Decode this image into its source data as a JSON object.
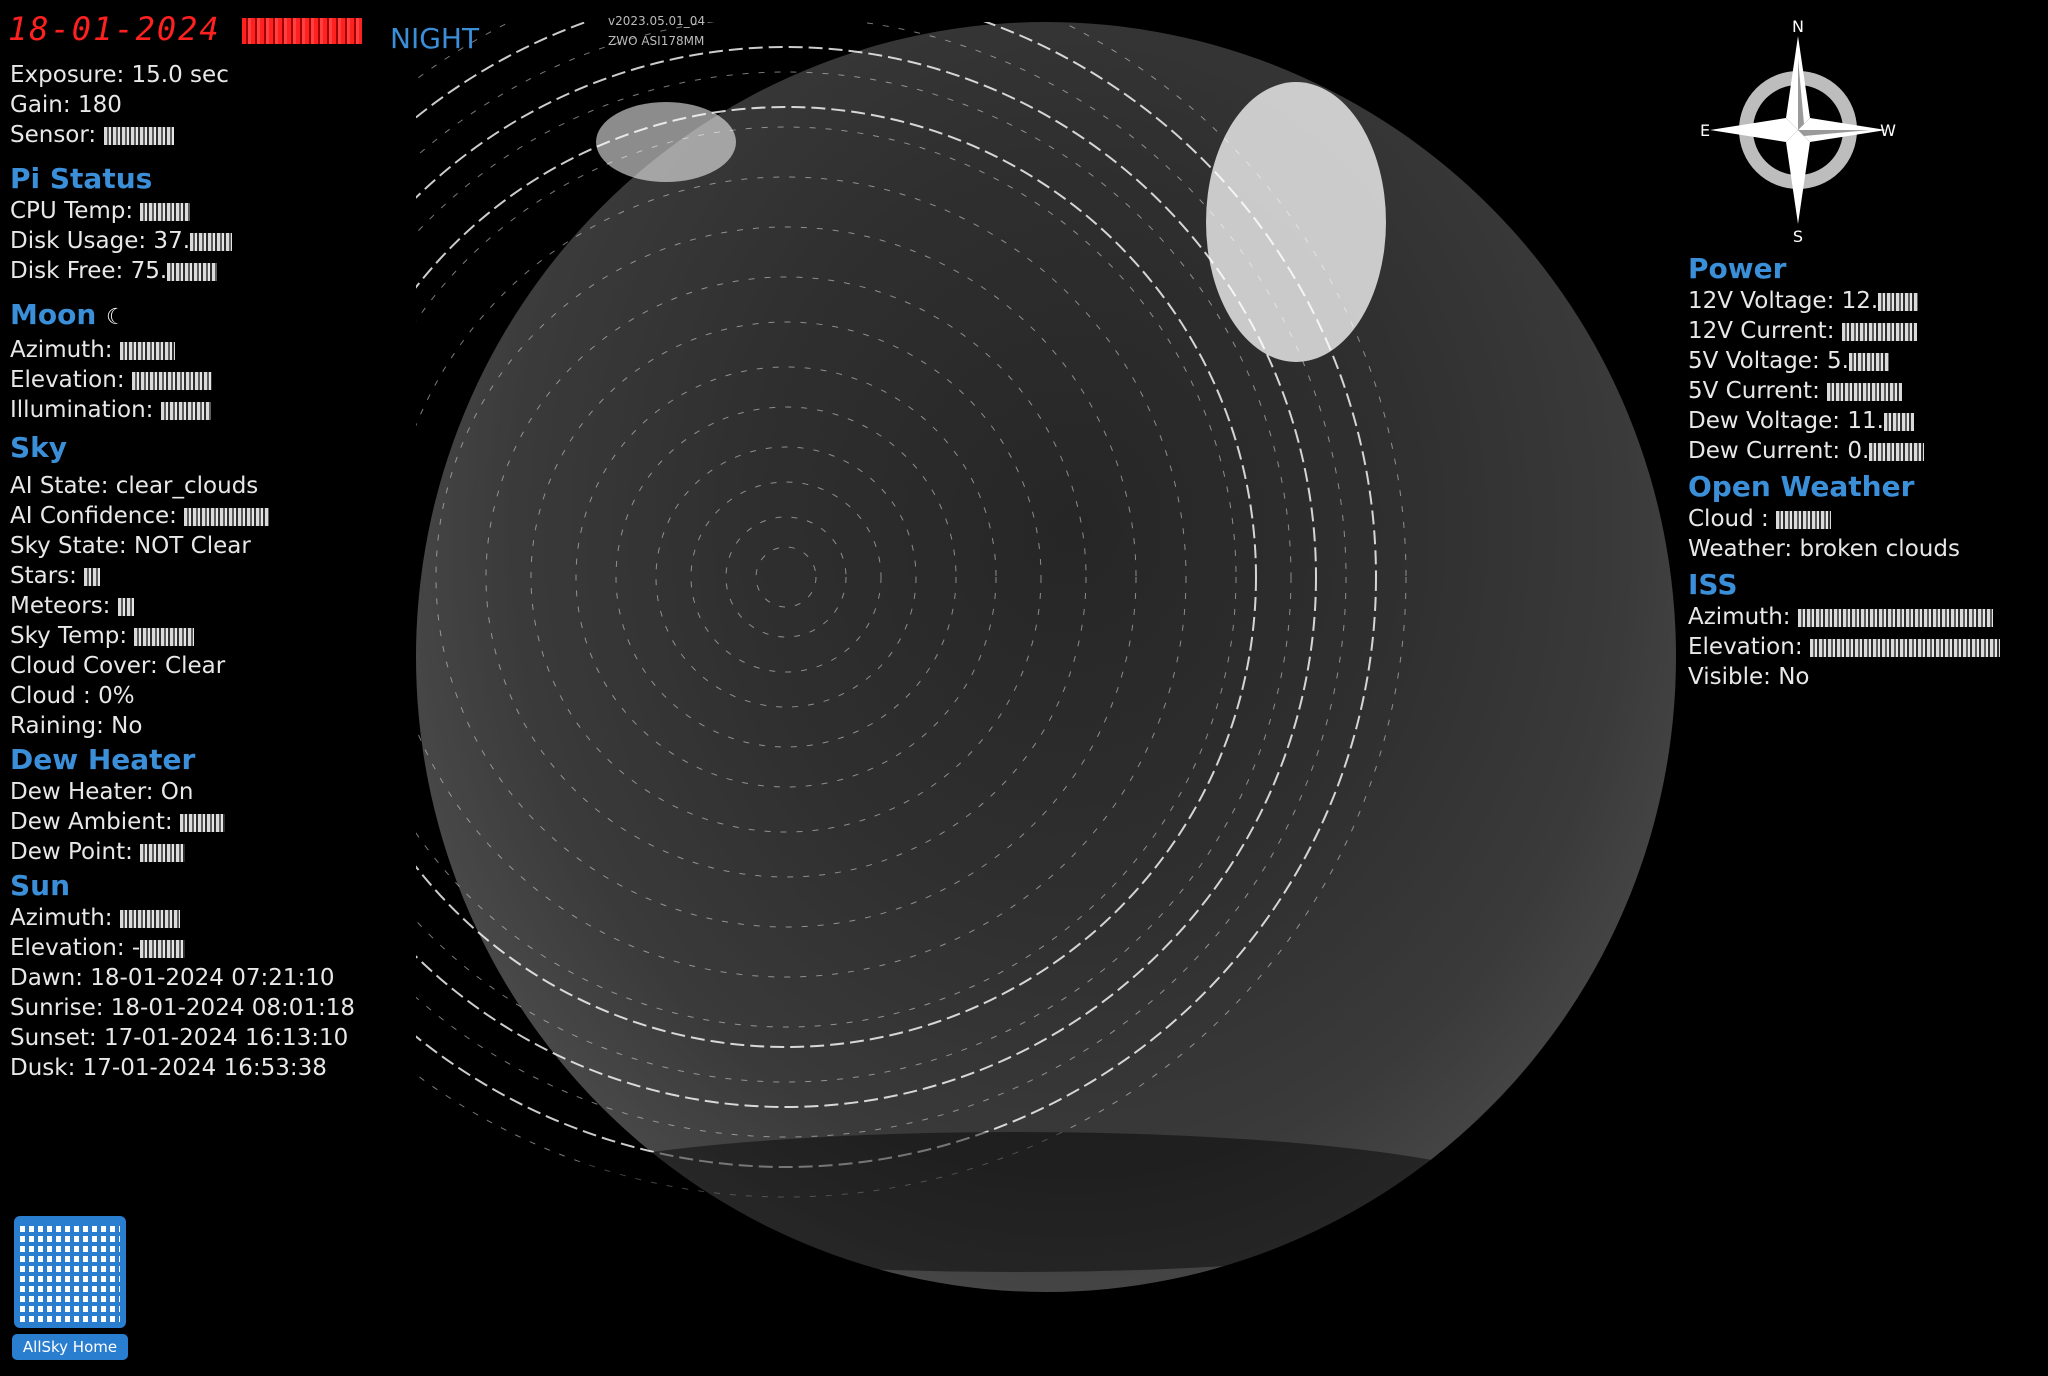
{
  "header": {
    "date": "18-01-2024",
    "mode": "NIGHT",
    "version": "v2023.05.01_04",
    "camera": "ZWO ASI178MM"
  },
  "camera_info": [
    {
      "label": "Exposure: 15.0 sec"
    },
    {
      "label": "Gain: 180"
    },
    {
      "label": "Sensor: "
    }
  ],
  "pi_status": {
    "title": "Pi Status",
    "rows": [
      "CPU Temp: ",
      "Disk Usage: 37.",
      "Disk Free: 75."
    ]
  },
  "moon": {
    "title": "Moon",
    "rows": [
      "Azimuth: ",
      "Elevation: ",
      "Illumination: "
    ]
  },
  "sky": {
    "title": "Sky",
    "rows": [
      "AI State: clear_clouds",
      "AI Confidence: ",
      "Sky State: NOT Clear",
      "Stars: ",
      "Meteors: ",
      "Sky Temp: ",
      "Cloud Cover: Clear",
      "Cloud : 0%",
      "Raining: No"
    ]
  },
  "dew_heater": {
    "title": "Dew Heater",
    "rows": [
      "Dew Heater: On",
      "Dew Ambient: ",
      "Dew Point: "
    ]
  },
  "sun": {
    "title": "Sun",
    "rows": [
      "Azimuth: ",
      "Elevation: -",
      "Dawn: 18-01-2024 07:21:10",
      "Sunrise: 18-01-2024 08:01:18",
      "Sunset: 17-01-2024 16:13:10",
      "Dusk: 17-01-2024 16:53:38"
    ]
  },
  "power": {
    "title": "Power",
    "rows": [
      "12V Voltage: 12.",
      "12V Current: ",
      "5V Voltage: 5.",
      "5V Current: ",
      "Dew Voltage: 11.",
      "Dew Current: 0."
    ]
  },
  "open_weather": {
    "title": "Open Weather",
    "rows": [
      "Cloud : ",
      "Weather: broken clouds"
    ]
  },
  "iss": {
    "title": "ISS",
    "rows": [
      "Azimuth: ",
      "Elevation: ",
      "Visible: No"
    ]
  },
  "compass": {
    "n": "N",
    "s": "S",
    "e": "E",
    "w": "W"
  },
  "qr": {
    "button_label": "AllSky Home"
  },
  "colors": {
    "accent": "#3a8fd8",
    "datetime": "#ff2020"
  }
}
